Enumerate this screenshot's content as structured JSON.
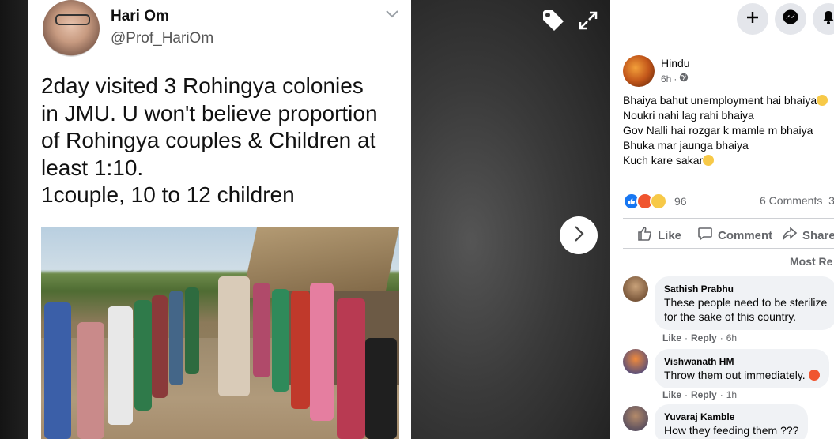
{
  "tweet": {
    "name": "Hari Om",
    "handle": "@Prof_HariOm",
    "text_lines": [
      "2day visited 3 Rohingya colonies",
      "in JMU. U won't believe proportion",
      "of Rohingya couples & Children at",
      "least 1:10.",
      "1couple, 10 to 12 children"
    ]
  },
  "viewer": {
    "tag_icon": "tag-icon",
    "expand_icon": "expand-icon",
    "next_icon": "chevron-right-icon"
  },
  "topbar": {
    "icons": [
      "plus-icon",
      "messenger-icon",
      "bell-icon"
    ]
  },
  "post": {
    "author": "Hindu",
    "time": "6h",
    "separator": "·",
    "text_lines": [
      "Bhaiya bahut unemployment hai bhaiya",
      "Noukri nahi lag rahi bhaiya",
      "Gov Nalli hai rozgar k mamle m bhaiya",
      "Bhuka mar jaunga bhaiya",
      "Kuch kare sakar"
    ],
    "reaction_count": "96",
    "comments_count": "6 Comments",
    "shares_partial": "3",
    "actions": {
      "like": "Like",
      "comment": "Comment",
      "share": "Share"
    },
    "sort_label": "Most Re"
  },
  "comments": [
    {
      "name": "Sathish Prabhu",
      "lines": [
        "These people need to be sterilize",
        "for the sake of this country."
      ],
      "like": "Like",
      "reply": "Reply",
      "time": "6h"
    },
    {
      "name": "Vishwanath HM",
      "lines": [
        "Throw them out immediately."
      ],
      "like": "Like",
      "reply": "Reply",
      "time": "1h"
    },
    {
      "name": "Yuvaraj Kamble",
      "lines": [
        "How they feeding them ???"
      ]
    }
  ],
  "colors": {
    "accent": "#1877f2",
    "text_secondary": "#65676b",
    "bubble": "#f0f2f5"
  }
}
